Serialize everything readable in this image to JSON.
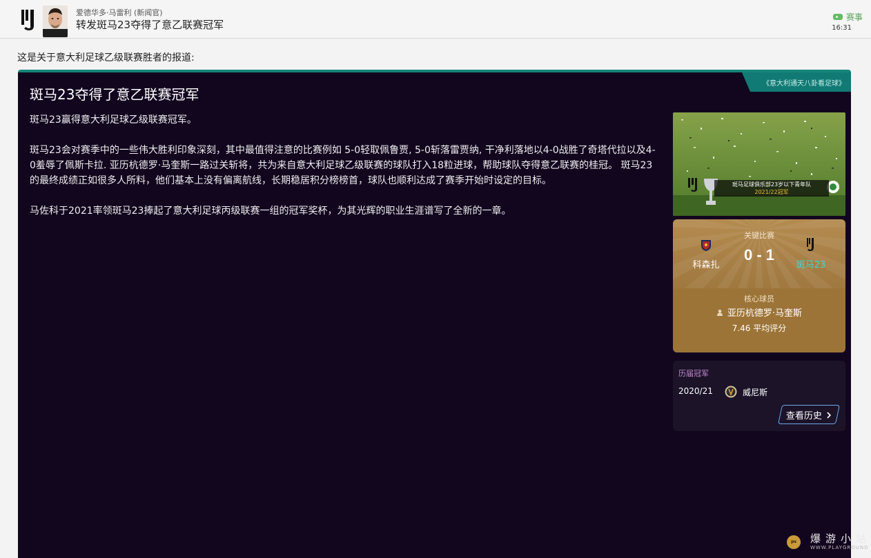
{
  "header": {
    "sender": "爱德华多·马雷利 (新闻官)",
    "subject": "转发斑马23夺得了意乙联赛冠军",
    "category": "赛事",
    "time": "16:31",
    "club_icon": "juventus-logo-icon",
    "avatar_icon": "person-avatar-icon"
  },
  "intro": "这是关于意大利足球乙级联赛胜者的报道:",
  "news": {
    "source": "《意大利通天八卦看足球》",
    "title": "斑马23夺得了意乙联赛冠军",
    "paragraphs": [
      "斑马23赢得意大利足球乙级联赛冠军。",
      "斑马23会对赛季中的一些伟大胜利印象深刻，其中最值得注意的比赛例如 5-0轻取佩鲁贾, 5-0斩落雷贾纳, 干净利落地以4-0战胜了奇塔代拉以及4-0羞辱了佩斯卡拉. 亚历杭德罗·马奎斯一路过关斩将，共为来自意大利足球乙级联赛的球队打入18粒进球，帮助球队夺得意乙联赛的桂冠。 斑马23的最终成绩正如很多人所料，他们基本上没有偏离航线，长期稳居积分榜榜首，球队也顺利达成了赛季开始时设定的目标。",
      "马佐科于2021率领斑马23捧起了意大利足球丙级联赛一组的冠军奖杯，为其光辉的职业生涯谱写了全新的一章。"
    ]
  },
  "trophy_image": {
    "caption_line1": "斑马足球俱乐部23岁以下青年队",
    "caption_line2": "2021/22冠军"
  },
  "key_match": {
    "label": "关键比赛",
    "home_team": "科森扎",
    "score": "0 - 1",
    "away_team": "斑马23",
    "player_label": "核心球员",
    "player_name": "亚历杭德罗·马奎斯",
    "rating": "7.46 平均评分",
    "away_color": "#3fd6d0"
  },
  "past_winners": {
    "title": "历届冠军",
    "season": "2020/21",
    "club": "威尼斯",
    "button": "查看历史"
  },
  "watermark": {
    "text": "爆游小站",
    "sub": "WWW.PLAYGROUND"
  }
}
